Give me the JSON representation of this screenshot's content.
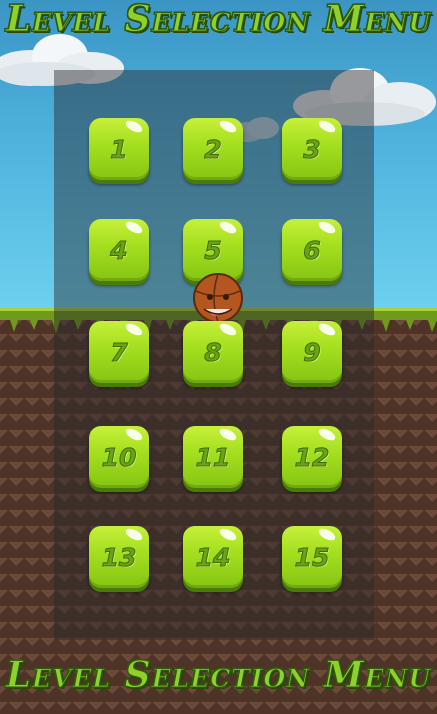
{
  "menu": {
    "title_top": "Level Selection Menu",
    "title_bottom": "Level Selection Menu"
  },
  "levels": [
    {
      "label": "1"
    },
    {
      "label": "2"
    },
    {
      "label": "3"
    },
    {
      "label": "4"
    },
    {
      "label": "5"
    },
    {
      "label": "6"
    },
    {
      "label": "7"
    },
    {
      "label": "8"
    },
    {
      "label": "9"
    },
    {
      "label": "10"
    },
    {
      "label": "11"
    },
    {
      "label": "12"
    },
    {
      "label": "13"
    },
    {
      "label": "14"
    },
    {
      "label": "15"
    }
  ],
  "colors": {
    "button_green": "#a3de1e",
    "title_green": "#8fd02a",
    "sky_blue": "#4fb3de",
    "ground_brown": "#4e3327"
  }
}
